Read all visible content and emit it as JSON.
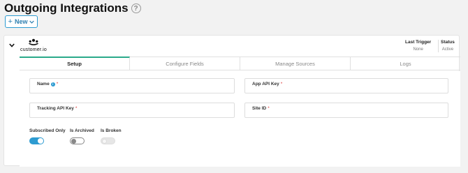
{
  "page": {
    "title": "Outgoing Integrations",
    "help_icon": "?"
  },
  "toolbar": {
    "new_plus": "+",
    "new_label": "New"
  },
  "integration": {
    "logo_text": "customer.io",
    "last_trigger_label": "Last Trigger",
    "last_trigger_value": "None",
    "status_label": "Status",
    "status_value": "Active"
  },
  "tabs": [
    {
      "label": "Setup",
      "active": true
    },
    {
      "label": "Configure Fields",
      "active": false
    },
    {
      "label": "Manage Sources",
      "active": false
    },
    {
      "label": "Logs",
      "active": false
    }
  ],
  "form": {
    "name_label": "Name",
    "app_api_key_label": "App API Key",
    "tracking_api_key_label": "Tracking API Key",
    "site_id_label": "Site ID",
    "required_mark": "*",
    "info_mark": "i"
  },
  "toggles": [
    {
      "label": "Subscribed Only",
      "state": "on"
    },
    {
      "label": "Is Archived",
      "state": "off"
    },
    {
      "label": "Is Broken",
      "state": "disabled"
    }
  ],
  "colors": {
    "accent": "#2d9bd1",
    "active_tab": "#2aaa8a",
    "required": "#dd3333"
  }
}
